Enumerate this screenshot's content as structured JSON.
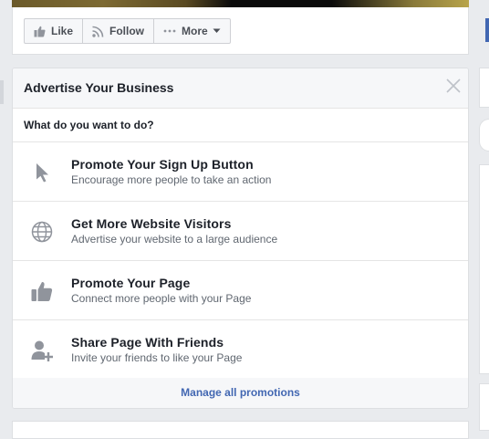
{
  "actions": {
    "like_label": "Like",
    "follow_label": "Follow",
    "more_label": "More"
  },
  "card": {
    "title": "Advertise Your Business",
    "question": "What do you want to do?",
    "options": [
      {
        "title": "Promote Your Sign Up Button",
        "desc": "Encourage more people to take an action",
        "icon": "cursor-icon"
      },
      {
        "title": "Get More Website Visitors",
        "desc": "Advertise your website to a large audience",
        "icon": "globe-icon"
      },
      {
        "title": "Promote Your Page",
        "desc": "Connect more people with your Page",
        "icon": "thumbs-up-icon"
      },
      {
        "title": "Share Page With Friends",
        "desc": "Invite your friends to like your Page",
        "icon": "add-friend-icon"
      }
    ],
    "footer_link": "Manage all promotions"
  },
  "colors": {
    "link": "#4267b2",
    "background": "#e9ebee",
    "icon_gray": "#90949c"
  }
}
